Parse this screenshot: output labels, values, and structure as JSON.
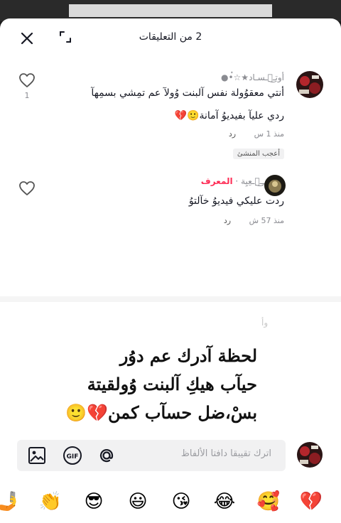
{
  "header": {
    "title": "2 من التعليقات"
  },
  "comments": [
    {
      "username": "أوتـ๋͜ـسـاد★☆๋•●",
      "text_line1": "أنتي معقوُولة نفس آلبنت وُولآ عم تمِشي بسمِهآ",
      "text_line2": "ردي عليآ بفيديوُ آمانة🙂💔",
      "time": "منذ 1 س",
      "reply": "رد",
      "likes": "1",
      "creator_liked": "أعجب المنشئ"
    },
    {
      "username": "مَرَاجَــِـ๋͜ـعِيِة",
      "tag": "المعرف",
      "text_line1": "ردت عليكي فيديوُ خآلتوُ",
      "time": "منذ 57 ش",
      "reply": "رد"
    }
  ],
  "video_overlay": {
    "line1": "لحظة  آدرك عم دوُر",
    "line2": "حيآب هيكِ آلبنت وُولقيتة",
    "line3": "بسْ،ضل حسآب كمن💔🙂",
    "hint": "وأ"
  },
  "input": {
    "placeholder": "اترك تقيبقا دافتا الألفاظ"
  },
  "emojis": [
    "💔",
    "🥰",
    "😂",
    "😘",
    "😃",
    "😎",
    "👏",
    "🤳"
  ],
  "colors": {
    "brand_red": "#fe2c55",
    "heart": "#e8495a",
    "text": "#161823",
    "muted": "#8a8b91"
  }
}
